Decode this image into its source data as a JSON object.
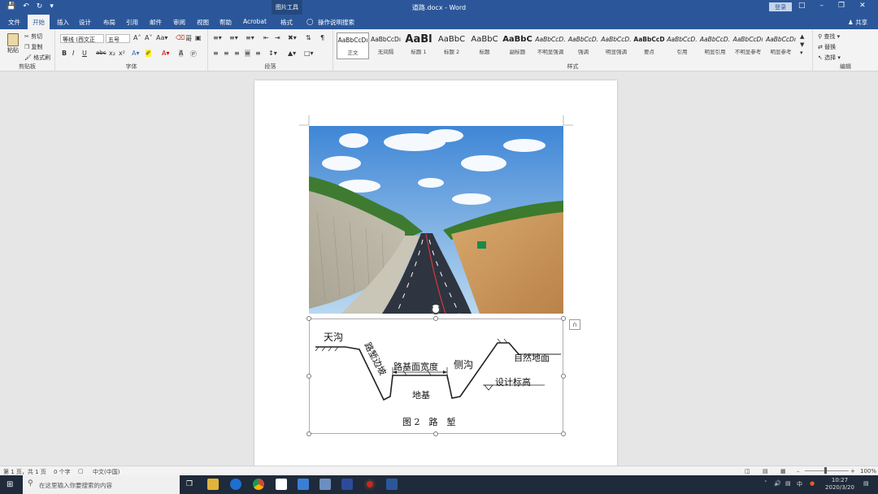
{
  "window": {
    "title": "道路.docx - Word",
    "contextual_tab": "图片工具",
    "login_label": "登录"
  },
  "tabs": [
    "文件",
    "开始",
    "插入",
    "设计",
    "布局",
    "引用",
    "邮件",
    "审阅",
    "视图",
    "帮助",
    "Acrobat",
    "格式"
  ],
  "active_tab": "开始",
  "tell_me": "操作说明搜索",
  "share_label": "共享",
  "ribbon": {
    "clipboard": {
      "label": "剪贴板",
      "paste": "粘贴",
      "cut": "剪切",
      "copy": "复制",
      "format_painter": "格式刷"
    },
    "font": {
      "label": "字体",
      "font_name": "等线 (西文正",
      "font_size": "五号"
    },
    "paragraph": {
      "label": "段落"
    },
    "styles": {
      "label": "样式",
      "items": [
        {
          "preview": "AaBbCcDı",
          "name": "正文"
        },
        {
          "preview": "AaBbCcDı",
          "name": "无间隔"
        },
        {
          "preview": "AaBl",
          "name": "标题 1"
        },
        {
          "preview": "AaBbC",
          "name": "标题 2"
        },
        {
          "preview": "AaBbC",
          "name": "标题"
        },
        {
          "preview": "AaBbC",
          "name": "副标题"
        },
        {
          "preview": "AaBbCcD.",
          "name": "不明显强调"
        },
        {
          "preview": "AaBbCcD.",
          "name": "强调"
        },
        {
          "preview": "AaBbCcD.",
          "name": "明显强调"
        },
        {
          "preview": "AaBbCcD",
          "name": "要点"
        },
        {
          "preview": "AaBbCcD.",
          "name": "引用"
        },
        {
          "preview": "AaBbCcD.",
          "name": "明显引用"
        },
        {
          "preview": "AaBbCcDı",
          "name": "不明显参考"
        },
        {
          "preview": "AaBbCcDı",
          "name": "明显参考"
        }
      ]
    },
    "editing": {
      "label": "编辑",
      "find": "查找",
      "replace": "替换",
      "select": "选择"
    }
  },
  "diagram": {
    "labels": {
      "ditch_top": "天沟",
      "slope": "路堑边坡",
      "width": "路基面宽度",
      "side_ditch": "侧沟",
      "ground": "自然地面",
      "design_elev": "设计标高",
      "subgrade": "地基"
    },
    "caption": "图 2　路　堑"
  },
  "status": {
    "page": "第 1 页，共 1 页",
    "words": "0 个字",
    "language": "中文(中国)",
    "zoom": "100%"
  },
  "taskbar": {
    "search_placeholder": "在这里输入你要搜索的内容",
    "time": "10:27",
    "date": "2020/3/20",
    "ime": "中"
  },
  "colors": {
    "word_blue": "#2b579a",
    "ribbon_bg": "#f3f3f3",
    "doc_bg": "#e6e6e6",
    "taskbar": "#1f2a3a"
  }
}
